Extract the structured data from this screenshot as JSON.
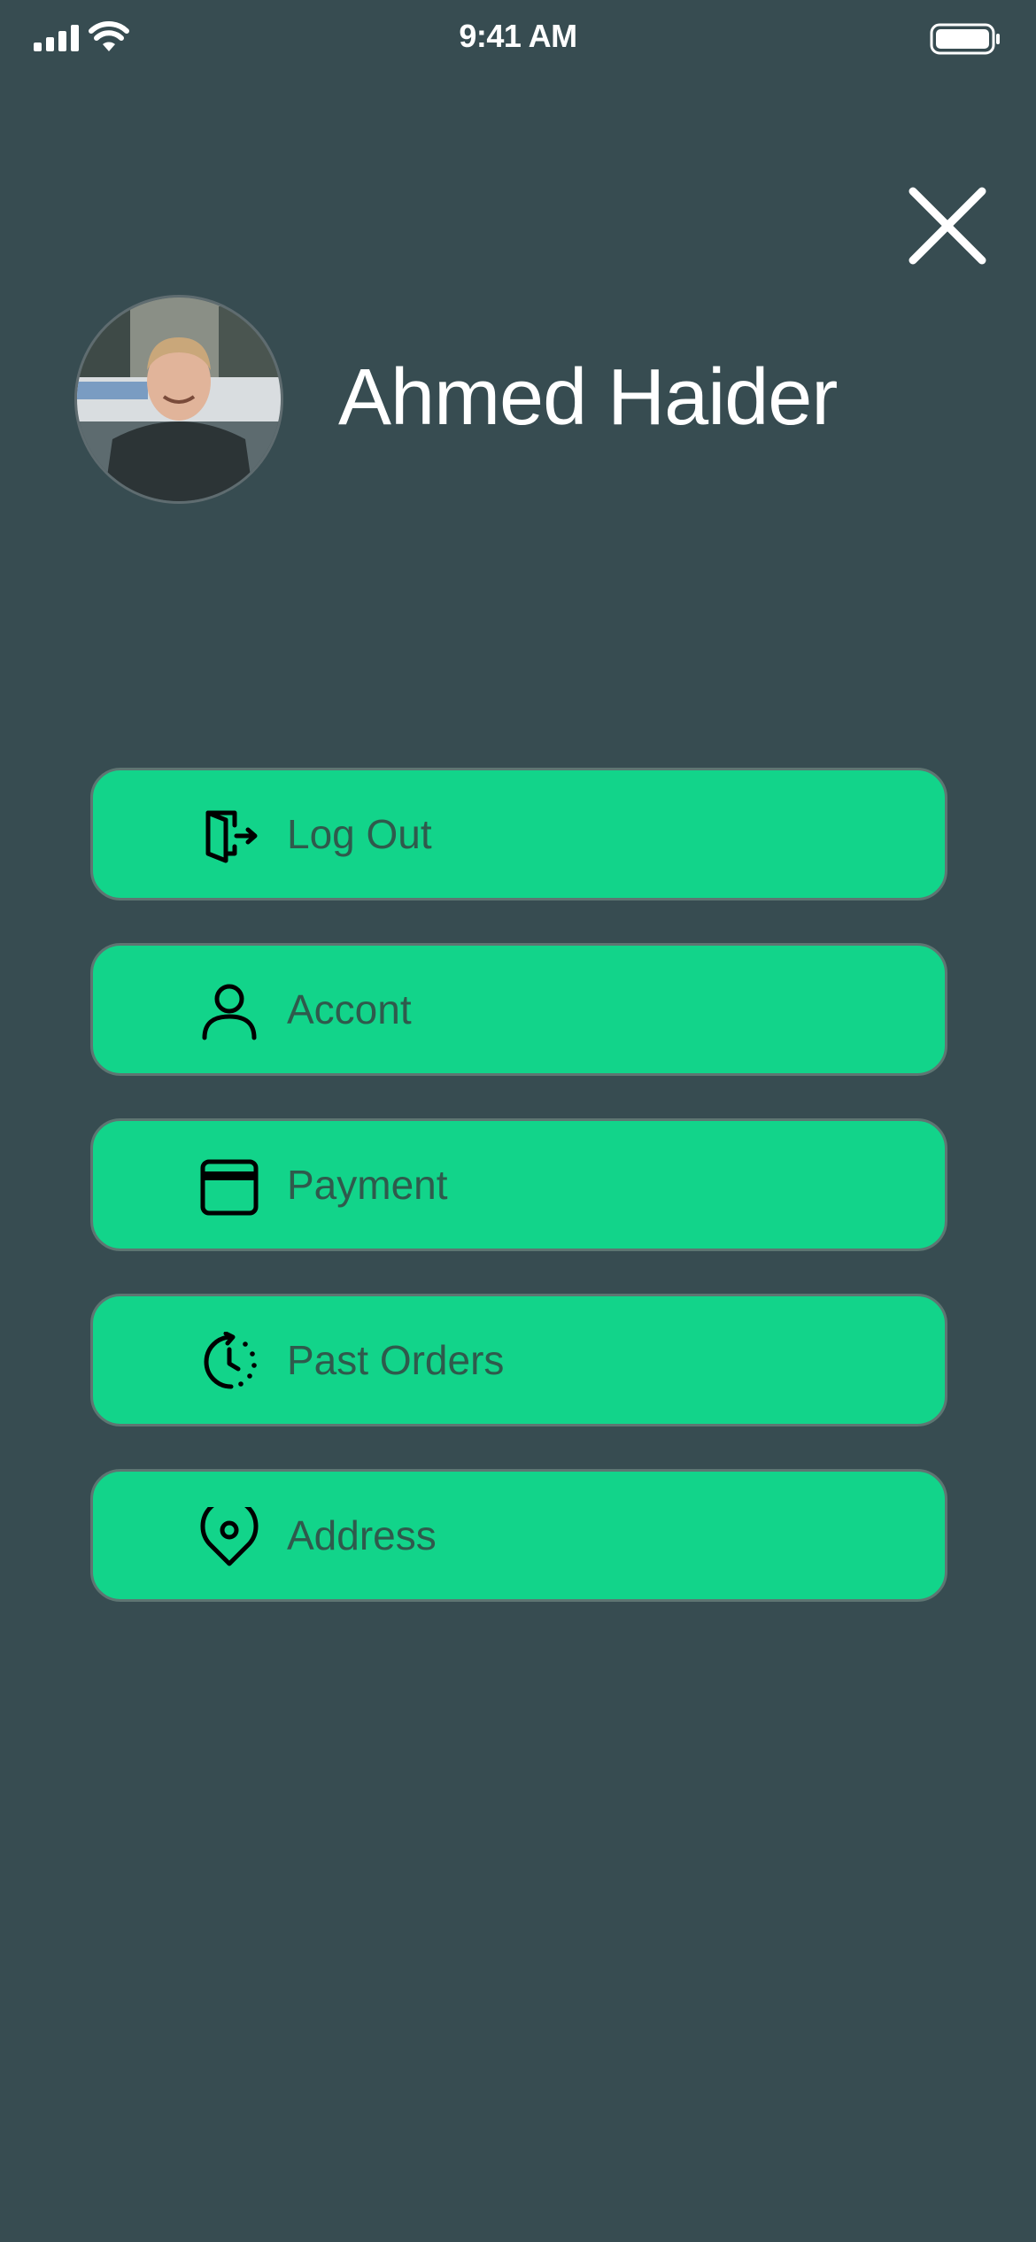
{
  "status_bar": {
    "time": "9:41 AM"
  },
  "profile": {
    "name": "Ahmed Haider"
  },
  "menu": {
    "items": [
      {
        "label": "Log Out",
        "icon": "log-out-icon"
      },
      {
        "label": "Accont",
        "icon": "user-icon"
      },
      {
        "label": "Payment",
        "icon": "credit-card-icon"
      },
      {
        "label": "Past Orders",
        "icon": "history-clock-icon"
      },
      {
        "label": "Address",
        "icon": "location-pin-icon"
      }
    ]
  },
  "colors": {
    "background": "#374c51",
    "button": "#12d48a",
    "button_text": "#2f5a4c",
    "name_text": "#ffffff"
  }
}
